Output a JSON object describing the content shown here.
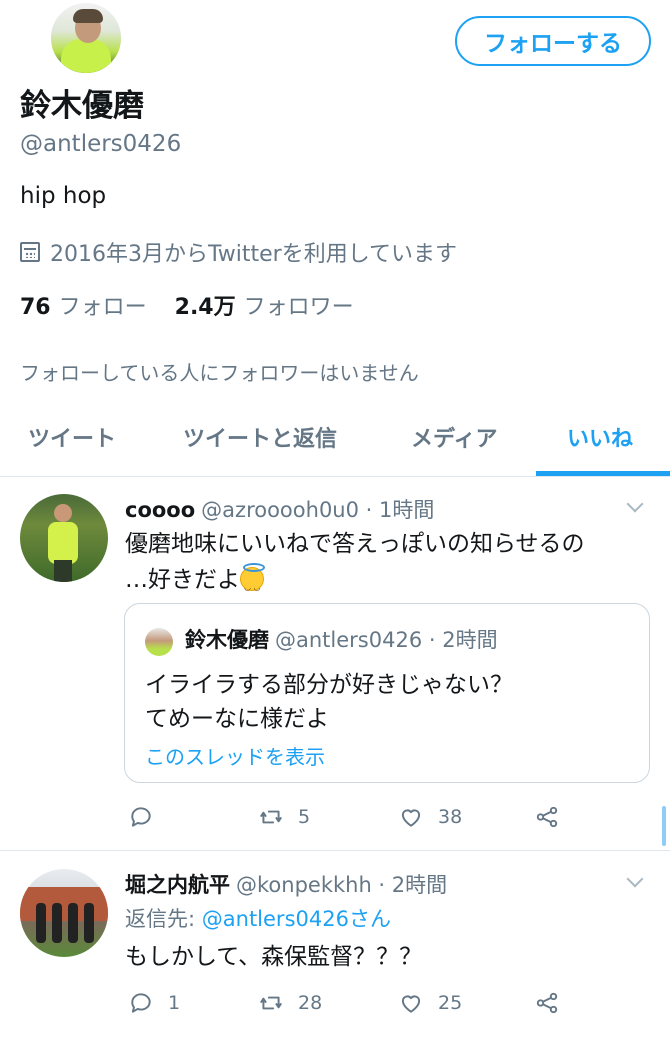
{
  "profile": {
    "name": "鈴木優磨",
    "handle": "@antlers0426",
    "bio": "hip hop",
    "joined": "2016年3月からTwitterを利用しています",
    "following_count": "76",
    "following_label": "フォロー",
    "followers_count": "2.4万",
    "followers_label": "フォロワー",
    "follow_button": "フォローする",
    "no_mutual": "フォローしている人にフォロワーはいません"
  },
  "tabs": [
    {
      "label": "ツイート"
    },
    {
      "label": "ツイートと返信"
    },
    {
      "label": "メディア"
    },
    {
      "label": "いいね",
      "active": true
    }
  ],
  "tweets": [
    {
      "name": "coooo",
      "handle": "@azrooooh0u0 · 1時間",
      "text_line1": "優磨地味にいいねで答えっぽいの知らせるの",
      "text_line2": "…好きだよ",
      "emoji": "smiling-face-with-halo",
      "quote": {
        "name": "鈴木優磨",
        "meta": "@antlers0426 · 2時間",
        "text_line1": "イライラする部分が好きじゃない？",
        "text_line2": "てめーなに様だよ",
        "thread_link": "このスレッドを表示"
      },
      "replies": "",
      "retweets": "5",
      "likes": "38"
    },
    {
      "name": "堀之内航平",
      "handle": "@konpekkhh · 2時間",
      "reply_prefix": "返信先: ",
      "reply_to": "@antlers0426さん",
      "text_line1": "もしかして、森保監督？？？",
      "replies": "1",
      "retweets": "28",
      "likes": "25"
    }
  ],
  "colors": {
    "accent": "#1da1f2",
    "secondary_text": "#657786",
    "primary_text": "#14171a",
    "border": "#e1e8ed"
  }
}
